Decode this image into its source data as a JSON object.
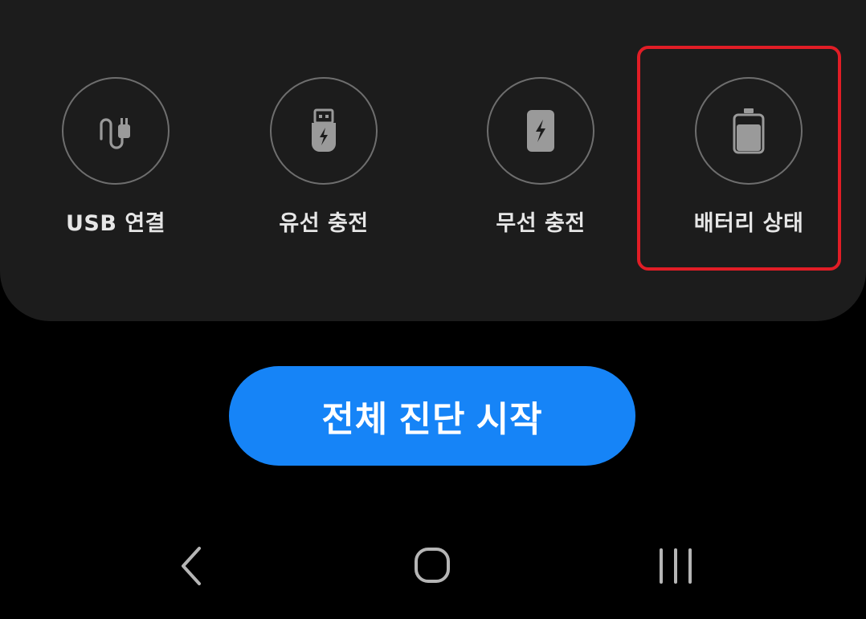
{
  "options": [
    {
      "label": "USB 연결",
      "icon": "usb-cable-icon"
    },
    {
      "label": "유선 충전",
      "icon": "usb-plug-icon"
    },
    {
      "label": "무선 충전",
      "icon": "wireless-charging-icon"
    },
    {
      "label": "배터리 상태",
      "icon": "battery-icon"
    }
  ],
  "start_button": {
    "label": "전체 진단 시작"
  },
  "nav": {
    "back": "back-icon",
    "home": "home-icon",
    "recents": "recents-icon"
  },
  "colors": {
    "panel": "#1c1c1c",
    "accent": "#1684f7",
    "highlight": "#e11d26",
    "icon": "#9a9a9a"
  }
}
